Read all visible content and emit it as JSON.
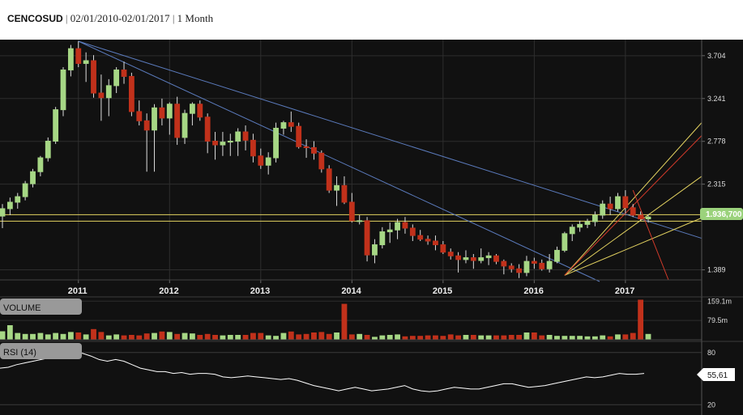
{
  "header": {
    "symbol": "CENCOSUD",
    "date_range": "02/01/2010-02/01/2017",
    "interval": "1 Month"
  },
  "colors": {
    "background": "#111111",
    "up": "#a6d785",
    "down": "#c1311b",
    "trendline_blue": "#5b7bbd",
    "trendline_yellow": "#e3d260",
    "trendline_red": "#d23a2a",
    "last_price_tag": "#9bd27c"
  },
  "chart_data": [
    {
      "type": "candlestick",
      "title": "",
      "x_ticks": [
        "2011",
        "2012",
        "2013",
        "2014",
        "2015",
        "2016",
        "2017"
      ],
      "y_ticks": [
        "3.704",
        "3.241",
        "2.778",
        "2.315",
        "1.389"
      ],
      "last_price_label": "1.936,700",
      "ohlc": [
        [
          1.97,
          2.1,
          1.84,
          2.05
        ],
        [
          2.05,
          2.17,
          1.98,
          2.12
        ],
        [
          2.12,
          2.22,
          2.05,
          2.18
        ],
        [
          2.18,
          2.35,
          2.14,
          2.32
        ],
        [
          2.32,
          2.48,
          2.28,
          2.45
        ],
        [
          2.45,
          2.62,
          2.4,
          2.6
        ],
        [
          2.6,
          2.82,
          2.56,
          2.78
        ],
        [
          2.78,
          3.15,
          2.75,
          3.12
        ],
        [
          3.12,
          3.58,
          3.05,
          3.55
        ],
        [
          3.55,
          3.82,
          3.48,
          3.78
        ],
        [
          3.78,
          3.86,
          3.58,
          3.62
        ],
        [
          3.62,
          3.74,
          3.42,
          3.65
        ],
        [
          3.65,
          3.71,
          3.25,
          3.3
        ],
        [
          3.3,
          3.5,
          3.0,
          3.25
        ],
        [
          3.25,
          3.45,
          3.05,
          3.38
        ],
        [
          3.38,
          3.58,
          3.3,
          3.55
        ],
        [
          3.55,
          3.64,
          3.4,
          3.48
        ],
        [
          3.48,
          3.52,
          3.05,
          3.1
        ],
        [
          3.1,
          3.22,
          2.95,
          3.0
        ],
        [
          3.0,
          3.08,
          2.45,
          2.9
        ],
        [
          2.9,
          3.18,
          2.45,
          3.14
        ],
        [
          3.14,
          3.24,
          2.95,
          3.03
        ],
        [
          3.03,
          3.2,
          2.85,
          3.18
        ],
        [
          3.18,
          3.26,
          2.74,
          2.82
        ],
        [
          2.82,
          3.12,
          2.75,
          3.08
        ],
        [
          3.08,
          3.2,
          2.95,
          3.18
        ],
        [
          3.18,
          3.22,
          3.0,
          3.04
        ],
        [
          3.04,
          3.08,
          2.65,
          2.78
        ],
        [
          2.78,
          2.88,
          2.58,
          2.74
        ],
        [
          2.74,
          2.88,
          2.62,
          2.77
        ],
        [
          2.77,
          2.86,
          2.62,
          2.78
        ],
        [
          2.78,
          2.92,
          2.62,
          2.88
        ],
        [
          2.88,
          2.95,
          2.68,
          2.79
        ],
        [
          2.79,
          2.86,
          2.55,
          2.62
        ],
        [
          2.62,
          2.7,
          2.48,
          2.52
        ],
        [
          2.52,
          2.66,
          2.42,
          2.6
        ],
        [
          2.6,
          2.98,
          2.55,
          2.92
        ],
        [
          2.92,
          3.0,
          2.85,
          2.98
        ],
        [
          2.98,
          3.1,
          2.88,
          2.94
        ],
        [
          2.94,
          2.98,
          2.7,
          2.72
        ],
        [
          2.72,
          2.8,
          2.6,
          2.71
        ],
        [
          2.71,
          2.78,
          2.58,
          2.65
        ],
        [
          2.65,
          2.68,
          2.44,
          2.48
        ],
        [
          2.48,
          2.52,
          2.22,
          2.25
        ],
        [
          2.25,
          2.4,
          2.08,
          2.3
        ],
        [
          2.3,
          2.4,
          2.1,
          2.12
        ],
        [
          2.12,
          2.22,
          1.9,
          1.92
        ],
        [
          1.92,
          1.98,
          1.88,
          1.92
        ],
        [
          1.92,
          1.96,
          1.48,
          1.55
        ],
        [
          1.55,
          1.72,
          1.46,
          1.66
        ],
        [
          1.66,
          1.85,
          1.62,
          1.8
        ],
        [
          1.8,
          1.9,
          1.68,
          1.82
        ],
        [
          1.82,
          1.94,
          1.72,
          1.9
        ],
        [
          1.9,
          1.96,
          1.78,
          1.84
        ],
        [
          1.84,
          1.88,
          1.7,
          1.76
        ],
        [
          1.76,
          1.82,
          1.7,
          1.72
        ],
        [
          1.72,
          1.76,
          1.66,
          1.7
        ],
        [
          1.7,
          1.76,
          1.6,
          1.66
        ],
        [
          1.66,
          1.7,
          1.56,
          1.58
        ],
        [
          1.58,
          1.62,
          1.5,
          1.54
        ],
        [
          1.54,
          1.58,
          1.36,
          1.5
        ],
        [
          1.5,
          1.6,
          1.46,
          1.52
        ],
        [
          1.52,
          1.56,
          1.4,
          1.49
        ],
        [
          1.49,
          1.62,
          1.46,
          1.52
        ],
        [
          1.52,
          1.58,
          1.44,
          1.54
        ],
        [
          1.54,
          1.56,
          1.45,
          1.48
        ],
        [
          1.48,
          1.5,
          1.34,
          1.43
        ],
        [
          1.43,
          1.46,
          1.36,
          1.4
        ],
        [
          1.4,
          1.45,
          1.3,
          1.36
        ],
        [
          1.36,
          1.54,
          1.32,
          1.48
        ],
        [
          1.48,
          1.52,
          1.4,
          1.46
        ],
        [
          1.46,
          1.5,
          1.38,
          1.4
        ],
        [
          1.4,
          1.56,
          1.36,
          1.48
        ],
        [
          1.48,
          1.64,
          1.46,
          1.6
        ],
        [
          1.6,
          1.8,
          1.58,
          1.78
        ],
        [
          1.78,
          1.88,
          1.7,
          1.85
        ],
        [
          1.85,
          1.92,
          1.8,
          1.88
        ],
        [
          1.88,
          1.94,
          1.84,
          1.91
        ],
        [
          1.91,
          2.02,
          1.86,
          1.98
        ],
        [
          1.98,
          2.14,
          1.94,
          2.1
        ],
        [
          2.1,
          2.18,
          1.98,
          2.05
        ],
        [
          2.05,
          2.22,
          2.02,
          2.18
        ],
        [
          2.18,
          2.25,
          2.0,
          2.06
        ],
        [
          2.06,
          2.1,
          1.96,
          1.98
        ],
        [
          1.98,
          2.02,
          1.92,
          1.94
        ],
        [
          1.94,
          1.99,
          1.9,
          1.96
        ]
      ]
    },
    {
      "type": "bar",
      "title": "VOLUME",
      "y_ticks": [
        "159.1m",
        "79.5m"
      ],
      "values": [
        35,
        60,
        28,
        24,
        24,
        28,
        22,
        28,
        24,
        32,
        30,
        22,
        44,
        32,
        18,
        22,
        18,
        20,
        18,
        26,
        28,
        34,
        32,
        24,
        28,
        26,
        20,
        24,
        20,
        18,
        20,
        20,
        20,
        28,
        28,
        18,
        16,
        28,
        34,
        22,
        24,
        30,
        32,
        24,
        30,
        28,
        22,
        24,
        20,
        12,
        18,
        20,
        22,
        14,
        16,
        16,
        18,
        18,
        16,
        22,
        18,
        20,
        20,
        18,
        18,
        18,
        18,
        20,
        20,
        30,
        30,
        18,
        20,
        16,
        16,
        16,
        16,
        14,
        14,
        18,
        14,
        22,
        22,
        28,
        30,
        24
      ],
      "spike_indices": [
        45,
        84
      ]
    },
    {
      "type": "line",
      "title": "RSI (14)",
      "y_ticks": [
        "80",
        "20"
      ],
      "last_value_label": "55,61",
      "values": [
        62,
        63,
        66,
        68,
        70,
        72,
        74,
        76,
        79,
        80,
        79,
        76,
        72,
        70,
        72,
        70,
        66,
        62,
        60,
        58,
        58,
        56,
        57,
        55,
        56,
        56,
        55,
        52,
        51,
        52,
        53,
        52,
        51,
        50,
        49,
        50,
        48,
        45,
        42,
        40,
        38,
        36,
        38,
        40,
        38,
        36,
        37,
        38,
        40,
        42,
        38,
        36,
        35,
        36,
        38,
        40,
        39,
        38,
        38,
        40,
        42,
        44,
        44,
        42,
        40,
        41,
        42,
        44,
        46,
        48,
        50,
        52,
        51,
        52,
        54,
        56,
        55,
        55,
        56
      ]
    }
  ]
}
